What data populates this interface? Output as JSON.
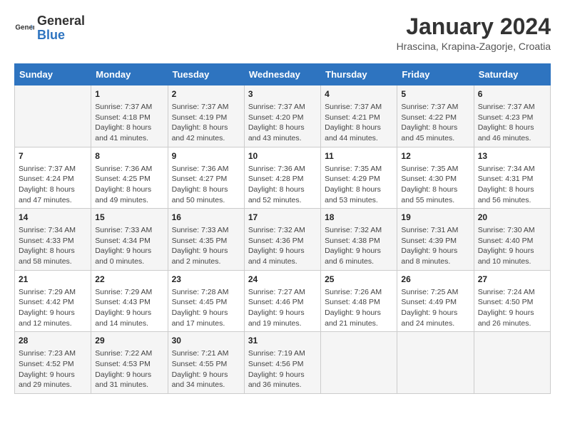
{
  "header": {
    "logo_general": "General",
    "logo_blue": "Blue",
    "month_title": "January 2024",
    "location": "Hrascina, Krapina-Zagorje, Croatia"
  },
  "days_of_week": [
    "Sunday",
    "Monday",
    "Tuesday",
    "Wednesday",
    "Thursday",
    "Friday",
    "Saturday"
  ],
  "weeks": [
    [
      {
        "day": "",
        "sunrise": "",
        "sunset": "",
        "daylight": ""
      },
      {
        "day": "1",
        "sunrise": "Sunrise: 7:37 AM",
        "sunset": "Sunset: 4:18 PM",
        "daylight": "Daylight: 8 hours and 41 minutes."
      },
      {
        "day": "2",
        "sunrise": "Sunrise: 7:37 AM",
        "sunset": "Sunset: 4:19 PM",
        "daylight": "Daylight: 8 hours and 42 minutes."
      },
      {
        "day": "3",
        "sunrise": "Sunrise: 7:37 AM",
        "sunset": "Sunset: 4:20 PM",
        "daylight": "Daylight: 8 hours and 43 minutes."
      },
      {
        "day": "4",
        "sunrise": "Sunrise: 7:37 AM",
        "sunset": "Sunset: 4:21 PM",
        "daylight": "Daylight: 8 hours and 44 minutes."
      },
      {
        "day": "5",
        "sunrise": "Sunrise: 7:37 AM",
        "sunset": "Sunset: 4:22 PM",
        "daylight": "Daylight: 8 hours and 45 minutes."
      },
      {
        "day": "6",
        "sunrise": "Sunrise: 7:37 AM",
        "sunset": "Sunset: 4:23 PM",
        "daylight": "Daylight: 8 hours and 46 minutes."
      }
    ],
    [
      {
        "day": "7",
        "sunrise": "Sunrise: 7:37 AM",
        "sunset": "Sunset: 4:24 PM",
        "daylight": "Daylight: 8 hours and 47 minutes."
      },
      {
        "day": "8",
        "sunrise": "Sunrise: 7:36 AM",
        "sunset": "Sunset: 4:25 PM",
        "daylight": "Daylight: 8 hours and 49 minutes."
      },
      {
        "day": "9",
        "sunrise": "Sunrise: 7:36 AM",
        "sunset": "Sunset: 4:27 PM",
        "daylight": "Daylight: 8 hours and 50 minutes."
      },
      {
        "day": "10",
        "sunrise": "Sunrise: 7:36 AM",
        "sunset": "Sunset: 4:28 PM",
        "daylight": "Daylight: 8 hours and 52 minutes."
      },
      {
        "day": "11",
        "sunrise": "Sunrise: 7:35 AM",
        "sunset": "Sunset: 4:29 PM",
        "daylight": "Daylight: 8 hours and 53 minutes."
      },
      {
        "day": "12",
        "sunrise": "Sunrise: 7:35 AM",
        "sunset": "Sunset: 4:30 PM",
        "daylight": "Daylight: 8 hours and 55 minutes."
      },
      {
        "day": "13",
        "sunrise": "Sunrise: 7:34 AM",
        "sunset": "Sunset: 4:31 PM",
        "daylight": "Daylight: 8 hours and 56 minutes."
      }
    ],
    [
      {
        "day": "14",
        "sunrise": "Sunrise: 7:34 AM",
        "sunset": "Sunset: 4:33 PM",
        "daylight": "Daylight: 8 hours and 58 minutes."
      },
      {
        "day": "15",
        "sunrise": "Sunrise: 7:33 AM",
        "sunset": "Sunset: 4:34 PM",
        "daylight": "Daylight: 9 hours and 0 minutes."
      },
      {
        "day": "16",
        "sunrise": "Sunrise: 7:33 AM",
        "sunset": "Sunset: 4:35 PM",
        "daylight": "Daylight: 9 hours and 2 minutes."
      },
      {
        "day": "17",
        "sunrise": "Sunrise: 7:32 AM",
        "sunset": "Sunset: 4:36 PM",
        "daylight": "Daylight: 9 hours and 4 minutes."
      },
      {
        "day": "18",
        "sunrise": "Sunrise: 7:32 AM",
        "sunset": "Sunset: 4:38 PM",
        "daylight": "Daylight: 9 hours and 6 minutes."
      },
      {
        "day": "19",
        "sunrise": "Sunrise: 7:31 AM",
        "sunset": "Sunset: 4:39 PM",
        "daylight": "Daylight: 9 hours and 8 minutes."
      },
      {
        "day": "20",
        "sunrise": "Sunrise: 7:30 AM",
        "sunset": "Sunset: 4:40 PM",
        "daylight": "Daylight: 9 hours and 10 minutes."
      }
    ],
    [
      {
        "day": "21",
        "sunrise": "Sunrise: 7:29 AM",
        "sunset": "Sunset: 4:42 PM",
        "daylight": "Daylight: 9 hours and 12 minutes."
      },
      {
        "day": "22",
        "sunrise": "Sunrise: 7:29 AM",
        "sunset": "Sunset: 4:43 PM",
        "daylight": "Daylight: 9 hours and 14 minutes."
      },
      {
        "day": "23",
        "sunrise": "Sunrise: 7:28 AM",
        "sunset": "Sunset: 4:45 PM",
        "daylight": "Daylight: 9 hours and 17 minutes."
      },
      {
        "day": "24",
        "sunrise": "Sunrise: 7:27 AM",
        "sunset": "Sunset: 4:46 PM",
        "daylight": "Daylight: 9 hours and 19 minutes."
      },
      {
        "day": "25",
        "sunrise": "Sunrise: 7:26 AM",
        "sunset": "Sunset: 4:48 PM",
        "daylight": "Daylight: 9 hours and 21 minutes."
      },
      {
        "day": "26",
        "sunrise": "Sunrise: 7:25 AM",
        "sunset": "Sunset: 4:49 PM",
        "daylight": "Daylight: 9 hours and 24 minutes."
      },
      {
        "day": "27",
        "sunrise": "Sunrise: 7:24 AM",
        "sunset": "Sunset: 4:50 PM",
        "daylight": "Daylight: 9 hours and 26 minutes."
      }
    ],
    [
      {
        "day": "28",
        "sunrise": "Sunrise: 7:23 AM",
        "sunset": "Sunset: 4:52 PM",
        "daylight": "Daylight: 9 hours and 29 minutes."
      },
      {
        "day": "29",
        "sunrise": "Sunrise: 7:22 AM",
        "sunset": "Sunset: 4:53 PM",
        "daylight": "Daylight: 9 hours and 31 minutes."
      },
      {
        "day": "30",
        "sunrise": "Sunrise: 7:21 AM",
        "sunset": "Sunset: 4:55 PM",
        "daylight": "Daylight: 9 hours and 34 minutes."
      },
      {
        "day": "31",
        "sunrise": "Sunrise: 7:19 AM",
        "sunset": "Sunset: 4:56 PM",
        "daylight": "Daylight: 9 hours and 36 minutes."
      },
      {
        "day": "",
        "sunrise": "",
        "sunset": "",
        "daylight": ""
      },
      {
        "day": "",
        "sunrise": "",
        "sunset": "",
        "daylight": ""
      },
      {
        "day": "",
        "sunrise": "",
        "sunset": "",
        "daylight": ""
      }
    ]
  ]
}
